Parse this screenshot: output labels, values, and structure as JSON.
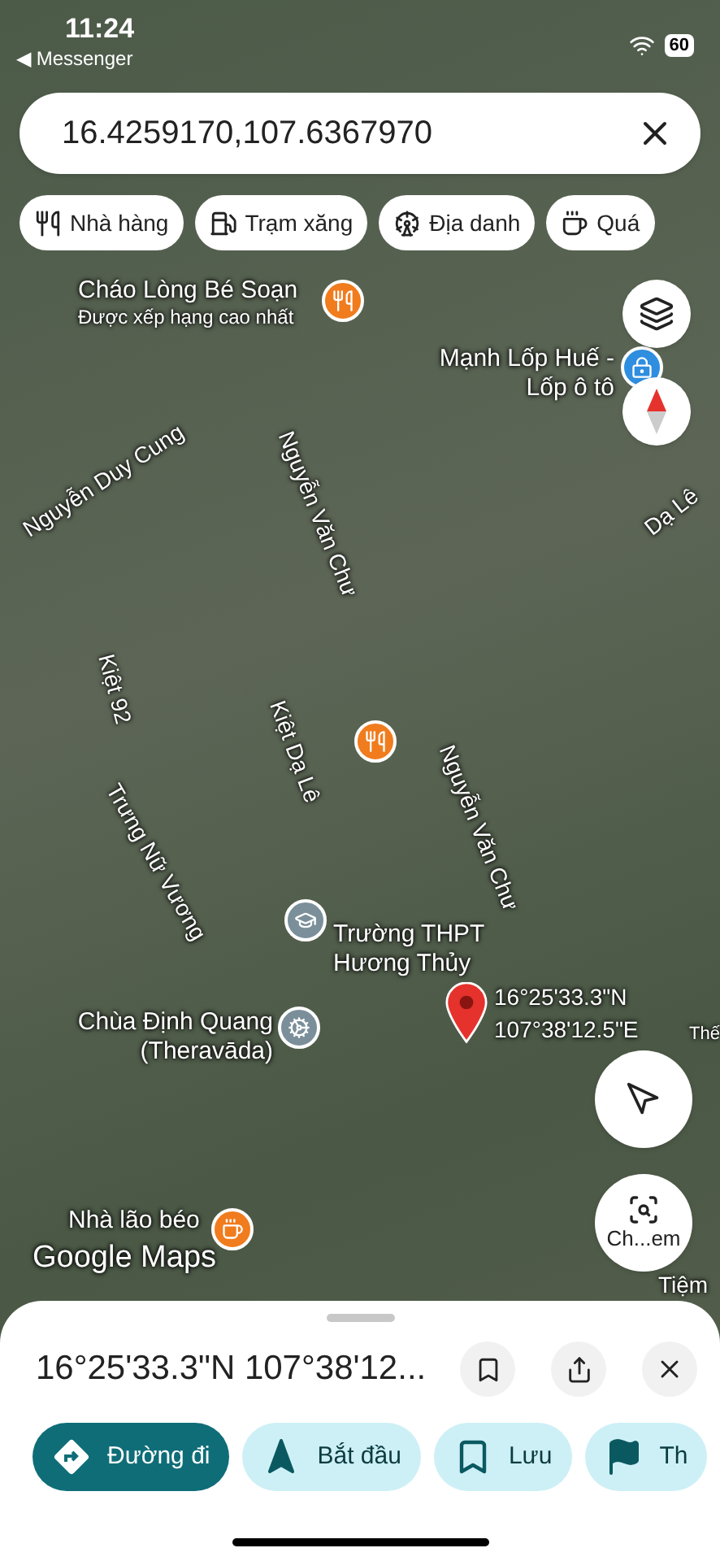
{
  "status_bar": {
    "time": "11:24",
    "back_app": "◀ Messenger",
    "battery": "60"
  },
  "search": {
    "value": "16.4259170,107.6367970"
  },
  "chips": [
    {
      "kind": "restaurant",
      "label": "Nhà hàng"
    },
    {
      "kind": "fuel",
      "label": "Trạm xăng"
    },
    {
      "kind": "landmark",
      "label": "Địa danh"
    },
    {
      "kind": "cafe",
      "label": "Quá"
    }
  ],
  "map": {
    "places": [
      {
        "kind": "restaurant",
        "name": "Cháo Lòng Bé Soạn",
        "note": "Được xếp hạng cao nhất"
      },
      {
        "kind": "shop",
        "name": "Mạnh Lốp Huế - Lốp ô tô"
      },
      {
        "kind": "restaurant"
      },
      {
        "kind": "school",
        "name": "Trường THPT Hương Thủy"
      },
      {
        "kind": "temple",
        "name": "Chùa Định Quang (Theravāda)"
      },
      {
        "kind": "cafe",
        "name": "Nhà lão béo"
      }
    ],
    "roads": [
      "Nguyễn Duy Cung",
      "Nguyễn Văn Chư",
      "Dạ Lê",
      "Kiệt 92",
      "Kiệt Dạ Lê",
      "Nguyễn Văn Chư",
      "Trưng Nữ Vương",
      "Thế",
      "Tiệm"
    ],
    "pin_label": "16°25'33.3\"N 107°38'12.5\"E",
    "logo": "Google Maps",
    "lens_label": "Ch...em"
  },
  "sheet": {
    "title": "16°25'33.3\"N 107°38'12...",
    "actions": [
      {
        "kind": "directions",
        "label": "Đường đi",
        "selected": true
      },
      {
        "kind": "start",
        "label": "Bắt đầu",
        "selected": false
      },
      {
        "kind": "save",
        "label": "Lưu",
        "selected": false
      },
      {
        "kind": "flag",
        "label": "Th",
        "selected": false
      }
    ]
  }
}
